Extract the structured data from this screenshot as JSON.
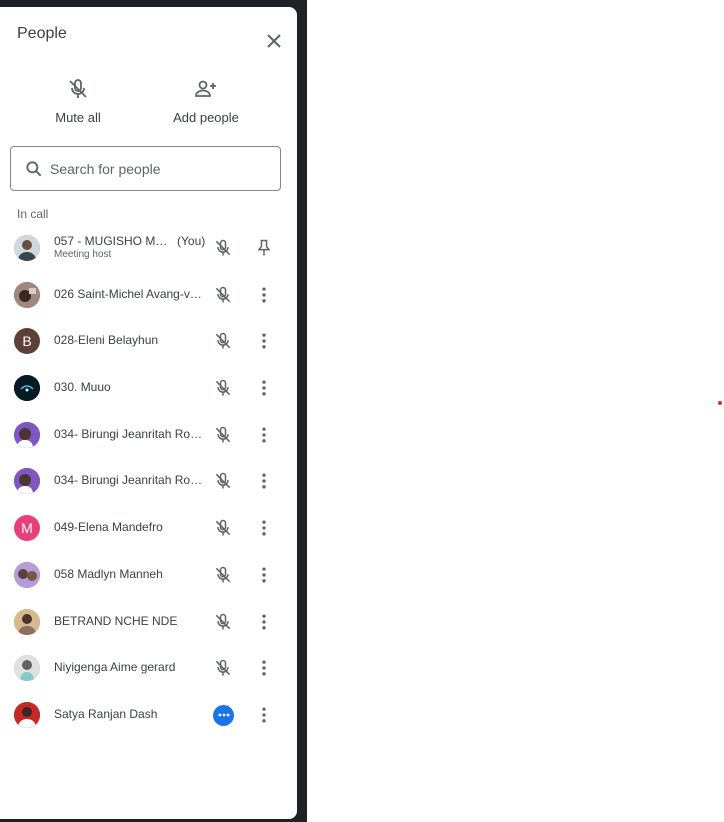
{
  "panel": {
    "title": "People",
    "actions": {
      "mute_all": "Mute all",
      "add_people": "Add people"
    },
    "search": {
      "placeholder": "Search for people"
    },
    "section_label": "In call"
  },
  "participants": [
    {
      "name": "057 - MUGISHO MAT...",
      "you_label": "(You)",
      "subtitle": "Meeting host",
      "avatar": "photo",
      "avatar_color": "#8d6e63",
      "audio": "muted",
      "action": "pin-icon"
    },
    {
      "name": "026 Saint-Michel Avang-vo...",
      "avatar": "photo",
      "avatar_color": "#6d5a4a",
      "audio": "muted",
      "action": "more-vert-icon"
    },
    {
      "name": "028-Eleni Belayhun",
      "avatar": "letter",
      "letter": "B",
      "avatar_color": "#5d4037",
      "audio": "muted",
      "action": "more-vert-icon"
    },
    {
      "name": "030. Muuo",
      "avatar": "photo",
      "avatar_color": "#0b2733",
      "audio": "muted",
      "action": "more-vert-icon"
    },
    {
      "name": "034- Birungi Jeanritah Roe...",
      "avatar": "photo",
      "avatar_color": "#6a4fbf",
      "audio": "muted",
      "action": "more-vert-icon"
    },
    {
      "name": "034- Birungi Jeanritah Roe...",
      "avatar": "photo",
      "avatar_color": "#6a4fbf",
      "audio": "muted",
      "action": "more-vert-icon"
    },
    {
      "name": "049-Elena Mandefro",
      "avatar": "letter",
      "letter": "M",
      "avatar_color": "#e8417a",
      "audio": "muted",
      "action": "more-vert-icon"
    },
    {
      "name": "058 Madlyn Manneh",
      "avatar": "photo",
      "avatar_color": "#8c7a9a",
      "audio": "muted",
      "action": "more-vert-icon"
    },
    {
      "name": "BETRAND NCHE NDE",
      "avatar": "photo",
      "avatar_color": "#b08d6a",
      "audio": "muted",
      "action": "more-vert-icon"
    },
    {
      "name": "Niyigenga Aime gerard",
      "avatar": "photo",
      "avatar_color": "#9aa0a6",
      "audio": "muted",
      "action": "more-vert-icon"
    },
    {
      "name": "Satya Ranjan Dash",
      "avatar": "photo",
      "avatar_color": "#b71c1c",
      "audio": "speaking",
      "action": "more-vert-icon"
    }
  ],
  "colors": {
    "accent": "#1a73e8",
    "text": "#3c4043",
    "muted_icon": "#5f6368",
    "sidebar_bg": "#202124"
  }
}
